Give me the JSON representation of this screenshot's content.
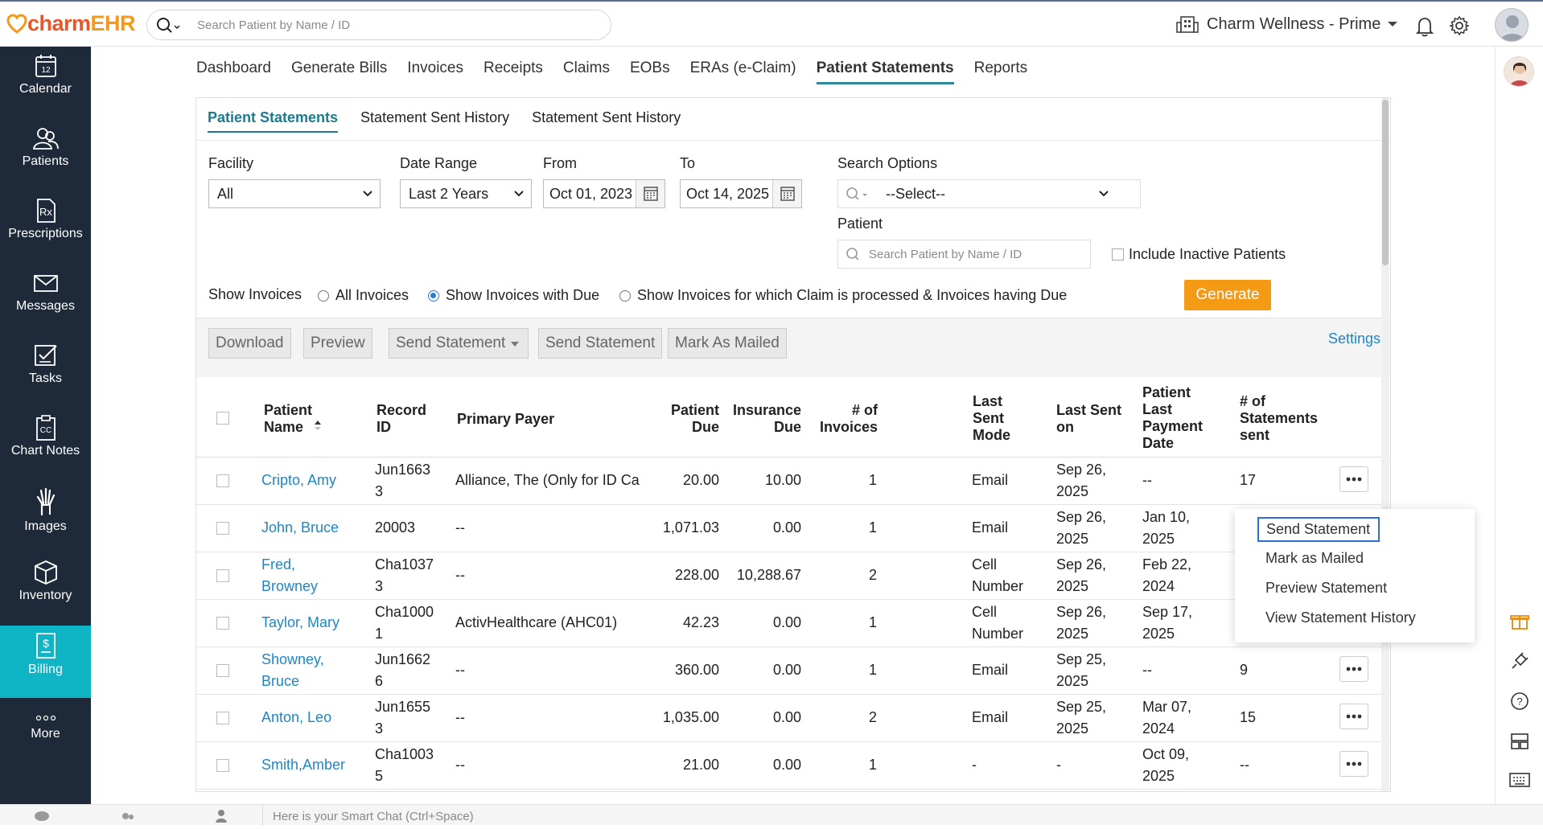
{
  "app": {
    "logo_part1": "charm",
    "logo_part2": "EHR",
    "search_placeholder": "Search Patient by Name / ID",
    "facility_name": "Charm Wellness - Prime"
  },
  "sidebar": {
    "items": [
      {
        "label": "Calendar",
        "icon": "calendar-icon"
      },
      {
        "label": "Patients",
        "icon": "patients-icon"
      },
      {
        "label": "Prescriptions",
        "icon": "prescription-icon"
      },
      {
        "label": "Messages",
        "icon": "envelope-icon"
      },
      {
        "label": "Tasks",
        "icon": "tasks-icon"
      },
      {
        "label": "Chart Notes",
        "icon": "chart-notes-icon"
      },
      {
        "label": "Images",
        "icon": "xray-hand-icon"
      },
      {
        "label": "Inventory",
        "icon": "box-icon"
      },
      {
        "label": "Billing",
        "icon": "billing-icon"
      },
      {
        "label": "More",
        "icon": "more-dots-icon"
      }
    ]
  },
  "nav": {
    "tabs": [
      "Dashboard",
      "Generate Bills",
      "Invoices",
      "Receipts",
      "Claims",
      "EOBs",
      "ERAs (e-Claim)",
      "Patient Statements",
      "Reports"
    ],
    "active": "Patient Statements"
  },
  "subtabs": [
    "Patient Statements",
    "Statement Sent History",
    "Statement Sent History"
  ],
  "filters": {
    "facility_label": "Facility",
    "facility_value": "All",
    "date_range_label": "Date Range",
    "date_range_value": "Last 2 Years",
    "from_label": "From",
    "from_value": "Oct 01, 2023",
    "to_label": "To",
    "to_value": "Oct 14, 2025",
    "search_options_label": "Search Options",
    "search_options_value": "--Select--",
    "patient_label": "Patient",
    "patient_placeholder": "Search Patient by Name / ID",
    "include_inactive_label": "Include Inactive Patients",
    "show_invoices_label": "Show Invoices",
    "radio_all": "All Invoices",
    "radio_due": "Show Invoices with Due",
    "radio_claim": "Show Invoices for which Claim is processed & Invoices having Due",
    "selected_radio": "due",
    "generate_label": "Generate"
  },
  "toolbar": {
    "download": "Download",
    "preview": "Preview",
    "send_statement_dd": "Send Statement",
    "send_statement": "Send Statement",
    "mark_as_mailed": "Mark As Mailed",
    "settings": "Settings"
  },
  "table": {
    "headers": {
      "patient_name_1": "Patient",
      "patient_name_2": "Name",
      "record_id_1": "Record",
      "record_id_2": "ID",
      "primary_payer": "Primary Payer",
      "patient_due_1": "Patient",
      "patient_due_2": "Due",
      "insurance_due_1": "Insurance",
      "insurance_due_2": "Due",
      "invoices_1": "# of",
      "invoices_2": "Invoices",
      "last_sent_mode_1": "Last",
      "last_sent_mode_2": "Sent",
      "last_sent_mode_3": "Mode",
      "last_sent_on_1": "Last Sent",
      "last_sent_on_2": "on",
      "last_payment_1": "Patient",
      "last_payment_2": "Last",
      "last_payment_3": "Payment",
      "last_payment_4": "Date",
      "statements_sent_1": "# of",
      "statements_sent_2": "Statements",
      "statements_sent_3": "sent"
    },
    "rows": [
      {
        "name1": "Cripto, Amy",
        "name2": "",
        "rec1": "Jun1663",
        "rec2": "3",
        "payer": "Alliance, The (Only for ID Card…",
        "pdue": "20.00",
        "idue": "10.00",
        "inv": "1",
        "mode1": "Email",
        "mode2": "",
        "sent1": "Sep 26,",
        "sent2": "2025",
        "pay1": "--",
        "pay2": "",
        "stm": "17"
      },
      {
        "name1": "John, Bruce",
        "name2": "",
        "rec1": "20003",
        "rec2": "",
        "payer": "--",
        "pdue": "1,071.03",
        "idue": "0.00",
        "inv": "1",
        "mode1": "Email",
        "mode2": "",
        "sent1": "Sep 26,",
        "sent2": "2025",
        "pay1": "Jan 10,",
        "pay2": "2025",
        "stm": ""
      },
      {
        "name1": "Fred,",
        "name2": "Browney",
        "rec1": "Cha1037",
        "rec2": "3",
        "payer": "--",
        "pdue": "228.00",
        "idue": "10,288.67",
        "inv": "2",
        "mode1": "Cell",
        "mode2": "Number",
        "sent1": "Sep 26,",
        "sent2": "2025",
        "pay1": "Feb 22,",
        "pay2": "2024",
        "stm": ""
      },
      {
        "name1": "Taylor, Mary",
        "name2": "",
        "rec1": "Cha1000",
        "rec2": "1",
        "payer": "ActivHealthcare (AHC01)",
        "pdue": "42.23",
        "idue": "0.00",
        "inv": "1",
        "mode1": "Cell",
        "mode2": "Number",
        "sent1": "Sep 26,",
        "sent2": "2025",
        "pay1": "Sep 17,",
        "pay2": "2025",
        "stm": ""
      },
      {
        "name1": "Showney,",
        "name2": "Bruce",
        "rec1": "Jun1662",
        "rec2": "6",
        "payer": "--",
        "pdue": "360.00",
        "idue": "0.00",
        "inv": "1",
        "mode1": "Email",
        "mode2": "",
        "sent1": "Sep 25,",
        "sent2": "2025",
        "pay1": "--",
        "pay2": "",
        "stm": "9"
      },
      {
        "name1": "Anton, Leo",
        "name2": "",
        "rec1": "Jun1655",
        "rec2": "3",
        "payer": "--",
        "pdue": "1,035.00",
        "idue": "0.00",
        "inv": "2",
        "mode1": "Email",
        "mode2": "",
        "sent1": "Sep 25,",
        "sent2": "2025",
        "pay1": "Mar 07,",
        "pay2": "2024",
        "stm": "15"
      },
      {
        "name1": "Smith,Amber",
        "name2": "",
        "rec1": "Cha1003",
        "rec2": "5",
        "payer": "--",
        "pdue": "21.00",
        "idue": "0.00",
        "inv": "1",
        "mode1": "-",
        "mode2": "",
        "sent1": "-",
        "sent2": "",
        "pay1": "Oct 09,",
        "pay2": "2025",
        "stm": "--"
      }
    ]
  },
  "context_menu": {
    "items": [
      "Send Statement",
      "Mark as Mailed",
      "Preview Statement",
      "View Statement History"
    ]
  },
  "bottom": {
    "chat_placeholder": "Here is your Smart Chat (Ctrl+Space)"
  },
  "colors": {
    "sidebar_bg": "#1e2a39",
    "sidebar_active": "#0fb5c4",
    "accent_link": "#1f86c6",
    "generate_button": "#f59a14"
  }
}
